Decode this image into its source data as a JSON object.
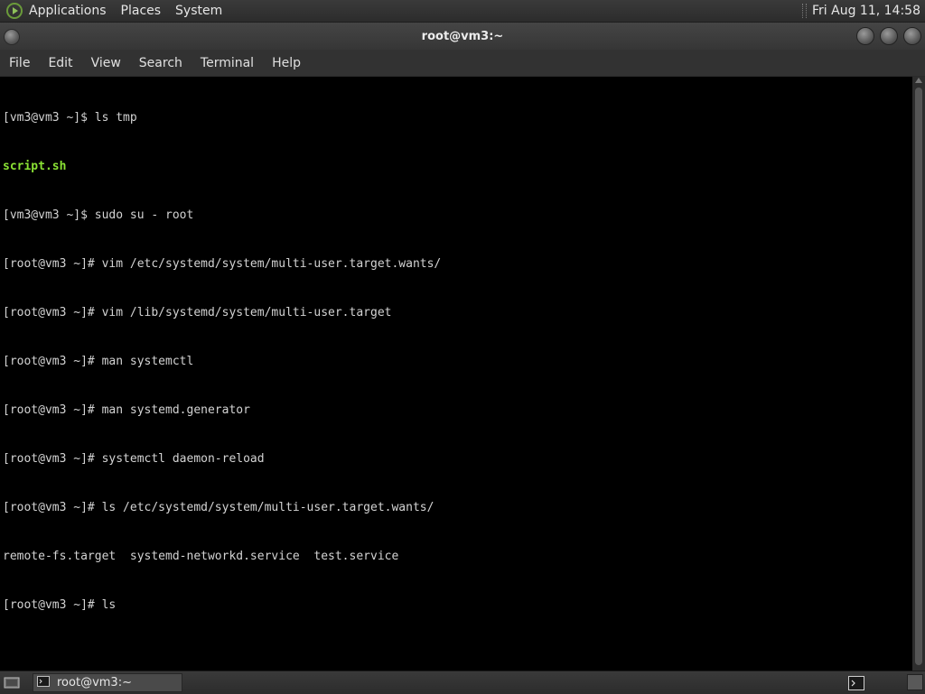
{
  "top_panel": {
    "menus": [
      "Applications",
      "Places",
      "System"
    ],
    "clock": "Fri Aug 11, 14:58"
  },
  "window": {
    "title": "root@vm3:~",
    "menus": [
      "File",
      "Edit",
      "View",
      "Search",
      "Terminal",
      "Help"
    ]
  },
  "terminal": {
    "lines": [
      {
        "text": "[vm3@vm3 ~]$ ls tmp",
        "style": "normal"
      },
      {
        "text": "script.sh",
        "style": "green"
      },
      {
        "text": "[vm3@vm3 ~]$ sudo su - root",
        "style": "normal"
      },
      {
        "text": "[root@vm3 ~]# vim /etc/systemd/system/multi-user.target.wants/",
        "style": "normal"
      },
      {
        "text": "[root@vm3 ~]# vim /lib/systemd/system/multi-user.target",
        "style": "normal"
      },
      {
        "text": "[root@vm3 ~]# man systemctl",
        "style": "normal"
      },
      {
        "text": "[root@vm3 ~]# man systemd.generator",
        "style": "normal"
      },
      {
        "text": "[root@vm3 ~]# systemctl daemon-reload",
        "style": "normal"
      },
      {
        "text": "[root@vm3 ~]# ls /etc/systemd/system/multi-user.target.wants/",
        "style": "normal"
      },
      {
        "text": "remote-fs.target  systemd-networkd.service  test.service",
        "style": "normal"
      },
      {
        "text": "[root@vm3 ~]# ls",
        "style": "normal"
      }
    ],
    "colors": {
      "background": "#000000",
      "foreground": "#d3d3d3",
      "green": "#8ae234"
    }
  },
  "bottom_panel": {
    "task_label": "root@vm3:~"
  },
  "icons": [
    "panel-logo-icon",
    "window-menu-icon",
    "minimize-icon",
    "maximize-icon",
    "close-icon",
    "show-desktop-icon",
    "terminal-icon",
    "workspace-switcher-icon"
  ]
}
